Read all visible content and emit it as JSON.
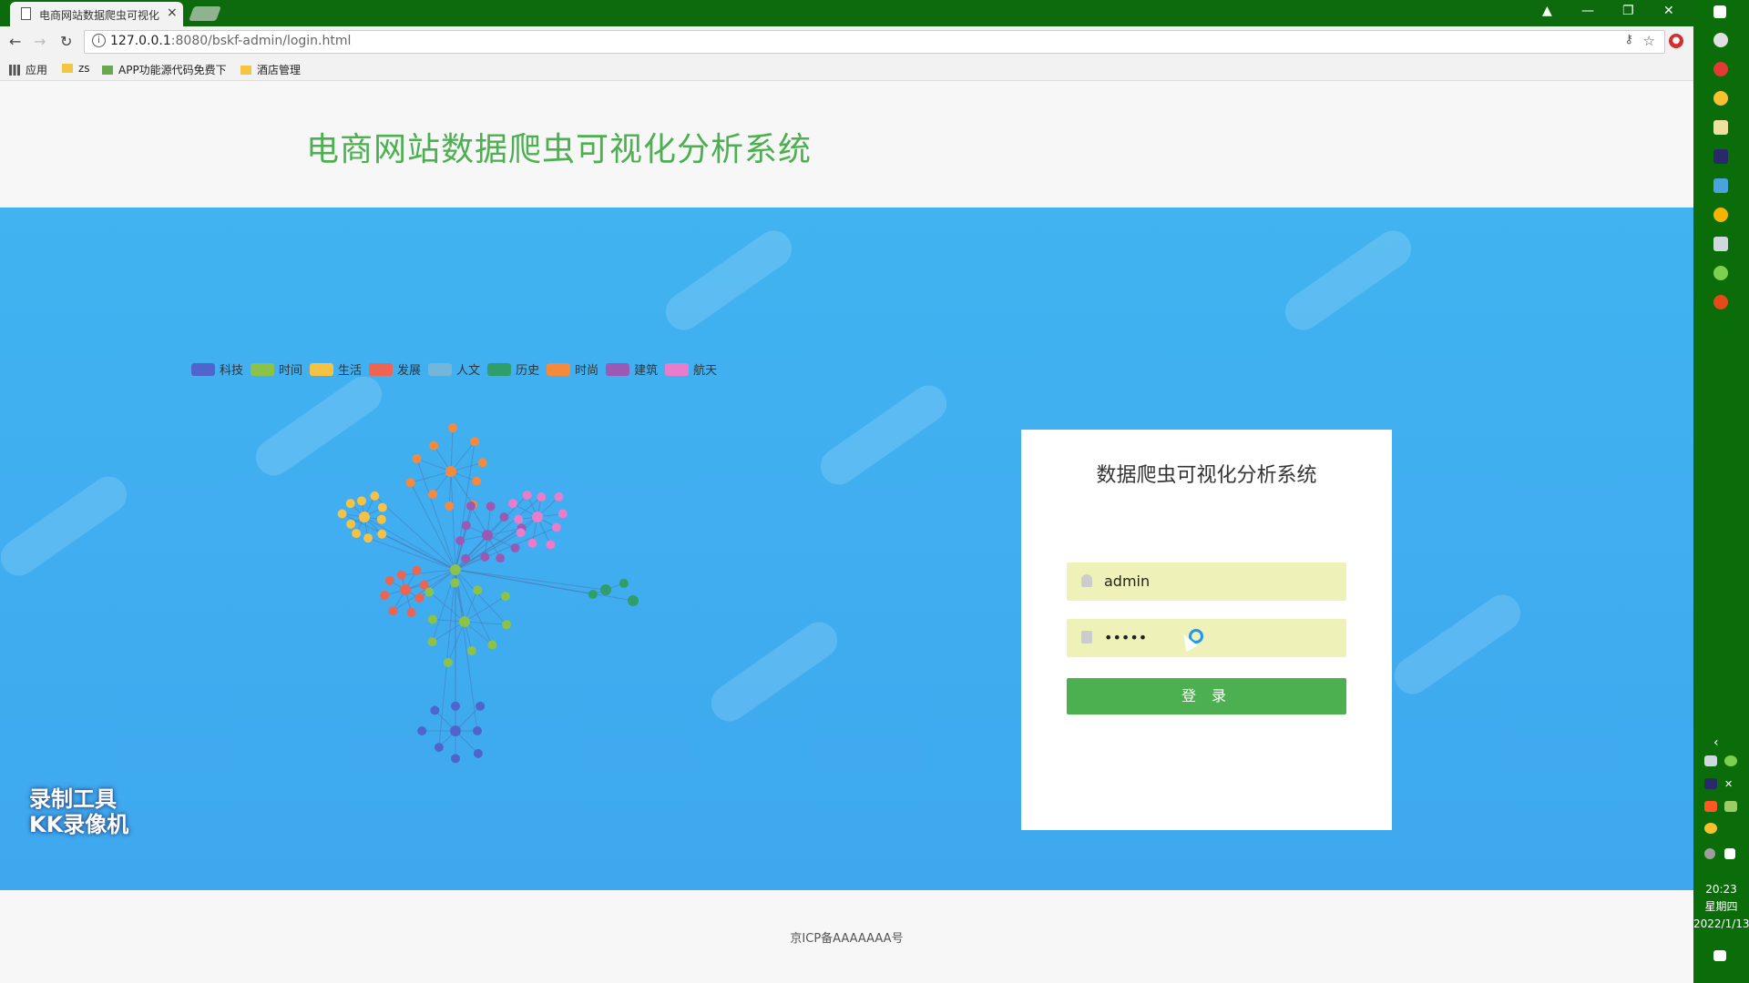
{
  "browser": {
    "tab_title": "电商网站数据爬虫可视化",
    "tab_close": "×",
    "url_host": "127.0.0.1",
    "url_path": ":8080/bskf-admin/login.html",
    "bookmarks": {
      "apps": "应用",
      "zs": "zs",
      "app_code": "APP功能源代码免费下",
      "hotel": "酒店管理"
    }
  },
  "header": {
    "title": "电商网站数据爬虫可视化分析系统"
  },
  "legend": [
    {
      "label": "科技",
      "color": "#4f65cc"
    },
    {
      "label": "时间",
      "color": "#8bc34a"
    },
    {
      "label": "生活",
      "color": "#f6c244"
    },
    {
      "label": "发展",
      "color": "#ee6352"
    },
    {
      "label": "人文",
      "color": "#72b6d9"
    },
    {
      "label": "历史",
      "color": "#2e9e6b"
    },
    {
      "label": "时尚",
      "color": "#f58a3c"
    },
    {
      "label": "建筑",
      "color": "#9b59b6"
    },
    {
      "label": "航天",
      "color": "#ea7ccc"
    }
  ],
  "login": {
    "title": "数据爬虫可视化分析系统",
    "username": "admin",
    "password": "•••••",
    "button": "登 录"
  },
  "watermark": {
    "line1": "录制工具",
    "line2": "KK录像机"
  },
  "footer": {
    "icp": "京ICP备AAAAAAA号"
  },
  "taskbar": {
    "time": "20:23",
    "weekday": "星期四",
    "date": "2022/1/13"
  }
}
